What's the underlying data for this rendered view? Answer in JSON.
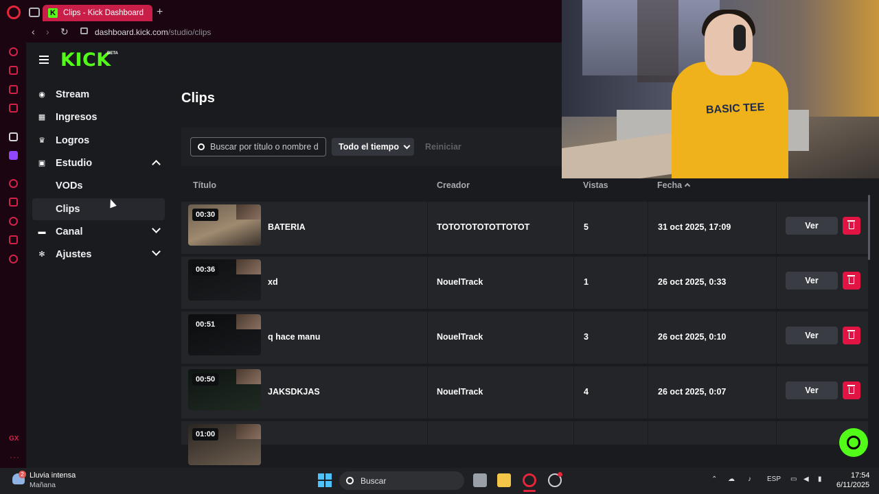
{
  "browser": {
    "tab_title": "Clips - Kick Dashboard",
    "tab_favicon": "K",
    "new_tab": "+",
    "url_host": "dashboard.kick.com",
    "url_path": "/studio/clips"
  },
  "app": {
    "logo": "KICK",
    "logo_badge": "BETA",
    "brand_color": "#53fc18",
    "accent_color": "#e11443"
  },
  "sidebar": {
    "items": [
      {
        "label": "Stream",
        "icon": "broadcast-icon"
      },
      {
        "label": "Ingresos",
        "icon": "chart-icon"
      },
      {
        "label": "Logros",
        "icon": "trophy-icon"
      },
      {
        "label": "Estudio",
        "icon": "studio-icon"
      },
      {
        "label": "VODs"
      },
      {
        "label": "Clips"
      },
      {
        "label": "Canal",
        "icon": "channel-icon"
      },
      {
        "label": "Ajustes",
        "icon": "gear-icon"
      }
    ]
  },
  "main": {
    "title": "Clips",
    "search_placeholder": "Buscar por título o nombre d",
    "time_filter": "Todo el tiempo",
    "reset_label": "Reiniciar",
    "columns": [
      "Título",
      "Creador",
      "Vistas",
      "Fecha"
    ],
    "view_label": "Ver",
    "rows": [
      {
        "duration": "00:30",
        "title": "BATERIA",
        "creator": "TOTOTOTOTOTTOTOT",
        "views": "5",
        "date": "31 oct 2025, 17:09"
      },
      {
        "duration": "00:36",
        "title": "xd",
        "creator": "NouelTrack",
        "views": "1",
        "date": "26 oct 2025, 0:33"
      },
      {
        "duration": "00:51",
        "title": "q hace manu",
        "creator": "NouelTrack",
        "views": "3",
        "date": "26 oct 2025, 0:10"
      },
      {
        "duration": "00:50",
        "title": "JAKSDKJAS",
        "creator": "NouelTrack",
        "views": "4",
        "date": "26 oct 2025, 0:07"
      },
      {
        "duration": "01:00",
        "title": "",
        "creator": "",
        "views": "",
        "date": ""
      }
    ]
  },
  "webcam": {
    "shirt_text": "BASIC TEE"
  },
  "taskbar": {
    "weather_title": "Lluvia intensa",
    "weather_sub": "Mañana",
    "weather_badge": "2",
    "search_label": "Buscar",
    "lang": "ESP",
    "time": "17:54",
    "date": "6/11/2025"
  }
}
